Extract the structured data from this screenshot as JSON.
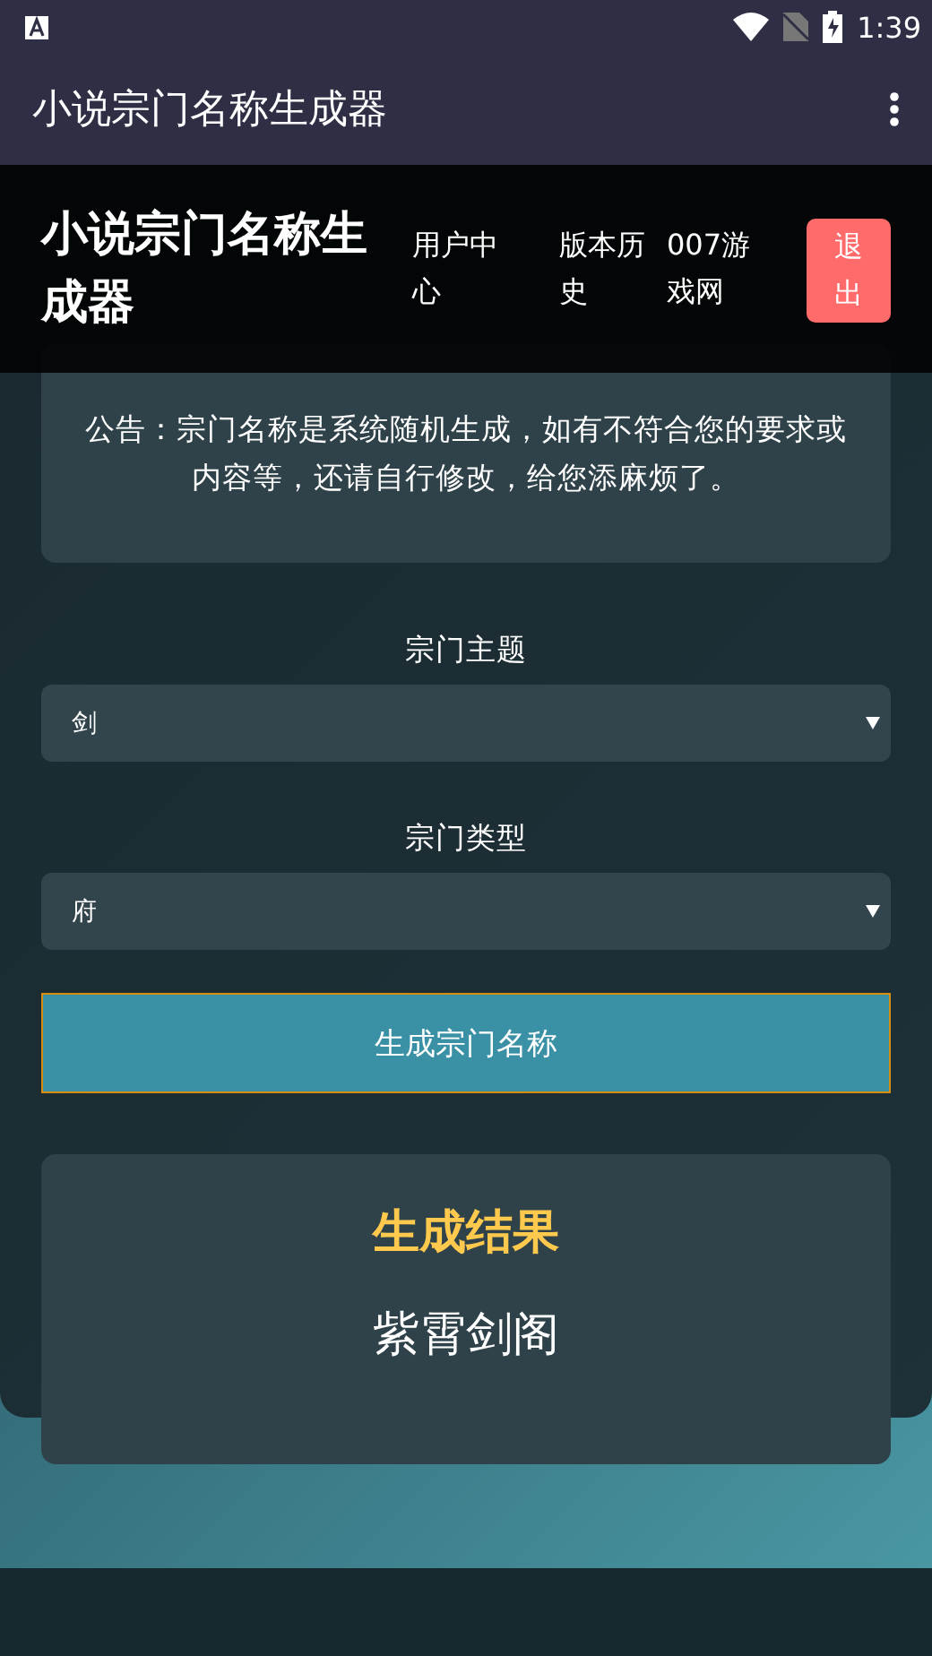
{
  "status_bar": {
    "time": "1:39"
  },
  "app_bar": {
    "title": "小说宗门名称生成器"
  },
  "site_header": {
    "title": "小说宗门名称生成器",
    "nav": [
      {
        "label": "用户中心"
      },
      {
        "label": "版本历史"
      },
      {
        "label": "007游戏网"
      }
    ],
    "logout": "退出"
  },
  "page": {
    "notice": "公告：宗门名称是系统随机生成，如有不符合您的要求或内容等，还请自行修改，给您添麻烦了。",
    "fields": [
      {
        "label": "宗门主题",
        "value": "剑"
      },
      {
        "label": "宗门类型",
        "value": "府"
      }
    ],
    "generate_button": "生成宗门名称",
    "result": {
      "title": "生成结果",
      "name": "紫霄剑阁"
    }
  }
}
